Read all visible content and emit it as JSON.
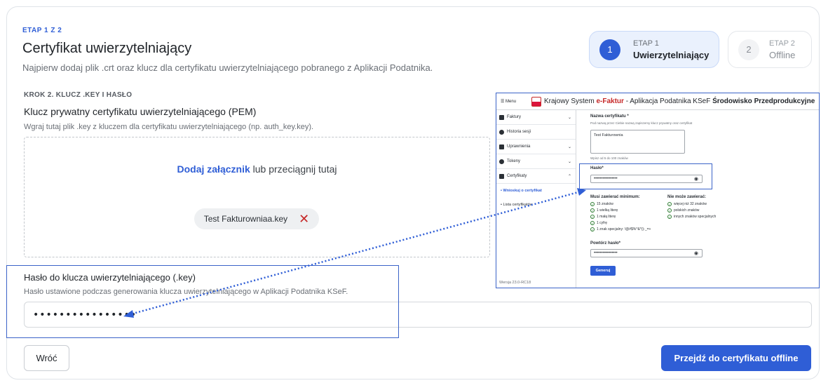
{
  "header": {
    "etap": "ETAP 1 Z 2",
    "title": "Certyfikat uwierzytelniający",
    "subtitle": "Najpierw dodaj plik .crt oraz klucz dla certyfikatu uwierzytelniającego pobranego z Aplikacji Podatnika."
  },
  "steps": [
    {
      "number": "1",
      "label": "ETAP 1",
      "title": "Uwierzytelniający",
      "active": true
    },
    {
      "number": "2",
      "label": "ETAP 2",
      "title": "Offline",
      "active": false
    }
  ],
  "key_section": {
    "krok": "KROK 2. KLUCZ .KEY I HASŁO",
    "title": "Klucz prywatny certyfikatu uwierzytelniającego (PEM)",
    "subtitle": "Wgraj tutaj plik .key z kluczem dla certyfikatu uwierzytelniającego (np. auth_key.key).",
    "drop_link": "Dodaj załącznik",
    "drop_text": " lub przeciągnij tutaj",
    "file_name": "Test Fakturowniaa.key",
    "remove_icon": "✕"
  },
  "password": {
    "title": "Hasło do klucza uwierzytelniającego (.key)",
    "subtitle": "Hasło ustawione podczas generowania klucza uwierzytelniającego w Aplikacji Podatnika KSeF.",
    "value": "••••••••••••••••"
  },
  "buttons": {
    "back": "Wróć",
    "next": "Przejdź do certyfikatu offline"
  },
  "inset": {
    "menu": "☰ Menu",
    "brand_prefix": "Krajowy System ",
    "brand_bold": "e-Faktur",
    "brand_suffix": " - Aplikacja Podatnika KSeF ",
    "brand_env": "Środowisko Przedprodukcyjne",
    "sidebar": [
      "Faktury",
      "Historia sesji",
      "Uprawnienia",
      "Tokeny",
      "Certyfikaty"
    ],
    "sidebar_sub": [
      "• Wnioskuj o certyfikat",
      "• Lista certyfikatów"
    ],
    "version": "Wersja 23.0-RC18",
    "cert_name_label": "Nazwa certyfikatu *",
    "cert_name_help": "Pod nazwą przez Ciebie nazwą zapiszemy klucz prywatny oraz certyfikat",
    "cert_name_value": "Test Fakturownia",
    "cert_name_count": "Wpisz od 5 do 100 znaków",
    "password_label": "Hasło*",
    "password_value": "••••••••••••••••",
    "must_title": "Musi zawierać minimum:",
    "must": [
      "15 znaków",
      "1 wielką literę",
      "1 małą literę",
      "1 cyfrę",
      "1 znak specjalny: !@#$%^&*()-_=+"
    ],
    "cannot_title": "Nie może zawierać:",
    "cannot": [
      "więcej niż 32 znaków",
      "polskich znaków",
      "innych znaków specjalnych"
    ],
    "repeat_label": "Powtórz hasło*",
    "repeat_value": "••••••••••••••••",
    "generate": "Generuj"
  },
  "colors": {
    "accent": "#2f5ed6",
    "danger": "#c62828",
    "highlight": "#3b63c8"
  }
}
